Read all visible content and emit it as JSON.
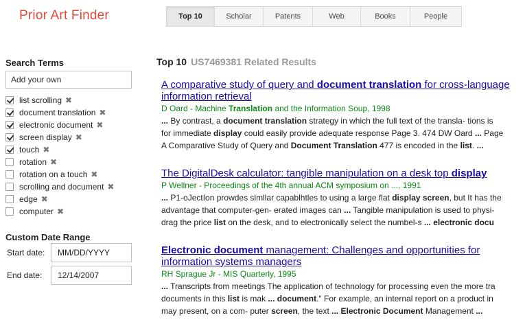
{
  "app": {
    "title": "Prior Art Finder"
  },
  "tabs": [
    {
      "label": "Top 10",
      "active": true
    },
    {
      "label": "Scholar"
    },
    {
      "label": "Patents"
    },
    {
      "label": "Web"
    },
    {
      "label": "Books"
    },
    {
      "label": "People"
    }
  ],
  "sidebar": {
    "search_title": "Search Terms",
    "add_placeholder": "Add your own",
    "terms": [
      {
        "label": "list scrolling",
        "checked": true
      },
      {
        "label": "document translation",
        "checked": true
      },
      {
        "label": "electronic document",
        "checked": true
      },
      {
        "label": "screen display",
        "checked": true
      },
      {
        "label": "touch",
        "checked": true
      },
      {
        "label": "rotation",
        "checked": false
      },
      {
        "label": "rotation on a touch",
        "checked": false
      },
      {
        "label": "scrolling and document",
        "checked": false
      },
      {
        "label": "edge",
        "checked": false
      },
      {
        "label": "computer",
        "checked": false
      }
    ],
    "remove_glyph": "✖",
    "date_title": "Custom Date Range",
    "start_label": "Start date:",
    "start_placeholder": "MM/DD/YYYY",
    "end_label": "End date:",
    "end_value": "12/14/2007"
  },
  "main": {
    "heading": "Top 10",
    "subheading": "US7469381 Related Results",
    "results": [
      {
        "title": "A comparative study of query and <b>document translation</b> for cross-language information retrieval",
        "meta": "D Oard - Machine <b>Translation</b> and the Information Soup, 1998",
        "snippet": [
          "<b>...</b> By contrast, a <b>document translation</b> strategy in which the full text of the transla- tions is",
          "for immediate <b>display</b> could easily provide adequate response Page 3. 474 DW Oard <b>...</b> Page",
          "A Comparative Study of Query and <b>Document Translation</b> 477 is encoded in the <b>list</b>. <b>...</b>"
        ]
      },
      {
        "title": "The DigitalDesk calculator: tangible manipulation on a desk top <b>display</b>",
        "meta": "P Wellner - Proceedings of the 4th annual ACM symposium on ..., 1991",
        "snippet": [
          "<b>...</b> P1-oJectIon prowdes slmllar capablhtles to using a large flat <b>display screen</b>, but It has the",
          "advantage that computer-gen- erated images can <b>...</b> Tangible manipulation is used to physi-",
          "drag the price <b>list</b> on the desk, and to electronically select the numbel-s <b>... electronic docu</b>"
        ]
      },
      {
        "title": "<b>Electronic document</b> management: Challenges and opportunities for information systems managers",
        "meta": "RH Sprague Jr - MIS Quarterly, 1995",
        "snippet": [
          "<b>...</b> Transcripts from meetings The application of technology for processing even the more tra",
          "documents in this <b>list</b> is mak <b>... document</b>.\" For example, an internal report on a product in",
          "may present, on a com- puter <b>screen</b>, the text <b>... Electronic Document</b> Management <b>... </b>"
        ]
      }
    ]
  },
  "colors": {
    "logo": "#dd4b39",
    "link": "#1a0dab",
    "meta": "#0e8a16",
    "subheading": "#999999"
  }
}
